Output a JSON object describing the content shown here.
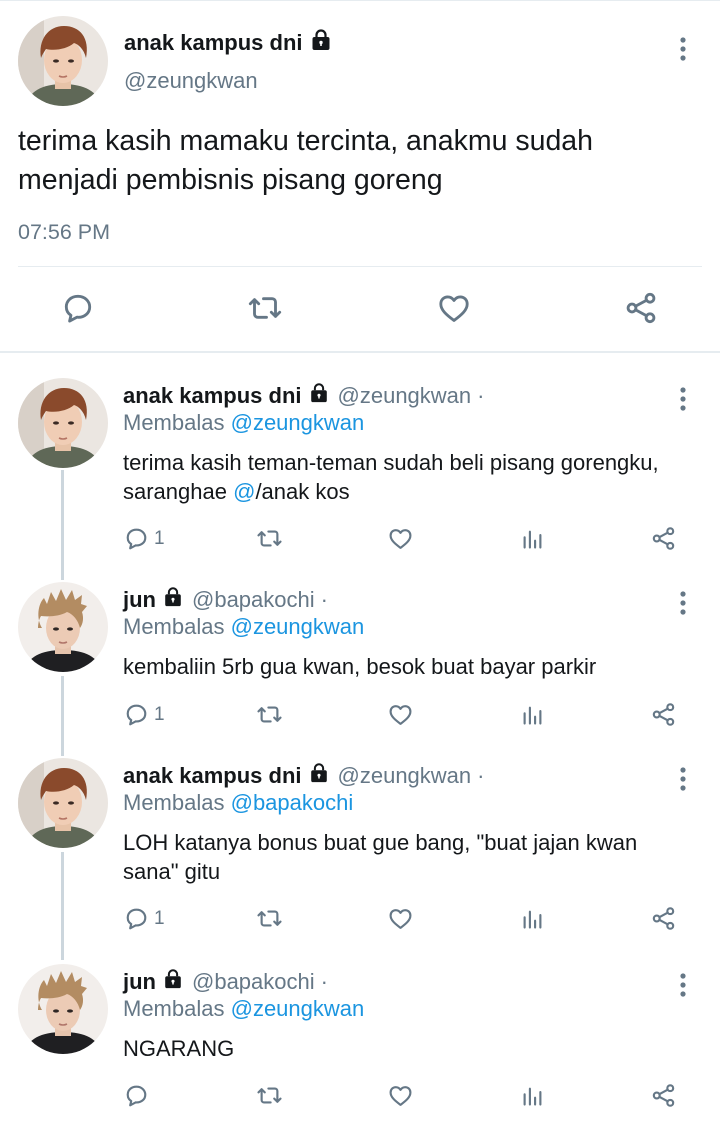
{
  "main_tweet": {
    "name": "anak kampus dni",
    "handle": "@zeungkwan",
    "text": "terima kasih mamaku tercinta, anakmu sudah menjadi pembisnis pisang goreng",
    "time": "07:56 PM"
  },
  "replies": [
    {
      "name": "anak kampus dni",
      "handle": "@zeungkwan",
      "dot": "·",
      "replying_label": "Membalas",
      "replying_to": "@zeungkwan",
      "text_a": "terima kasih teman-teman sudah beli pisang gorengku, saranghae ",
      "text_mention": "@",
      "text_b": "/anak kos",
      "reply_count": "1"
    },
    {
      "name": "jun",
      "handle": "@bapakochi",
      "dot": "·",
      "replying_label": "Membalas",
      "replying_to": "@zeungkwan",
      "text": "kembaliin 5rb gua kwan, besok buat bayar parkir",
      "reply_count": "1"
    },
    {
      "name": "anak kampus dni",
      "handle": "@zeungkwan",
      "dot": "·",
      "replying_label": "Membalas",
      "replying_to": "@bapakochi",
      "text": "LOH katanya bonus buat gue bang, \"buat jajan kwan sana\" gitu",
      "reply_count": "1"
    },
    {
      "name": "jun",
      "handle": "@bapakochi",
      "dot": "·",
      "replying_label": "Membalas",
      "replying_to": "@zeungkwan",
      "text": "NGARANG",
      "reply_count": ""
    }
  ],
  "icons": {
    "reply": "speech-bubble-icon",
    "retweet": "retweet-icon",
    "like": "heart-icon",
    "share": "share-icon",
    "analytics": "bar-chart-icon",
    "lock": "lock-icon",
    "more": "vertical-dots-icon"
  },
  "colors": {
    "accent": "#1b95e0",
    "secondary_text": "#657786",
    "primary_text": "#14171a",
    "divider": "#e6ecf0"
  }
}
